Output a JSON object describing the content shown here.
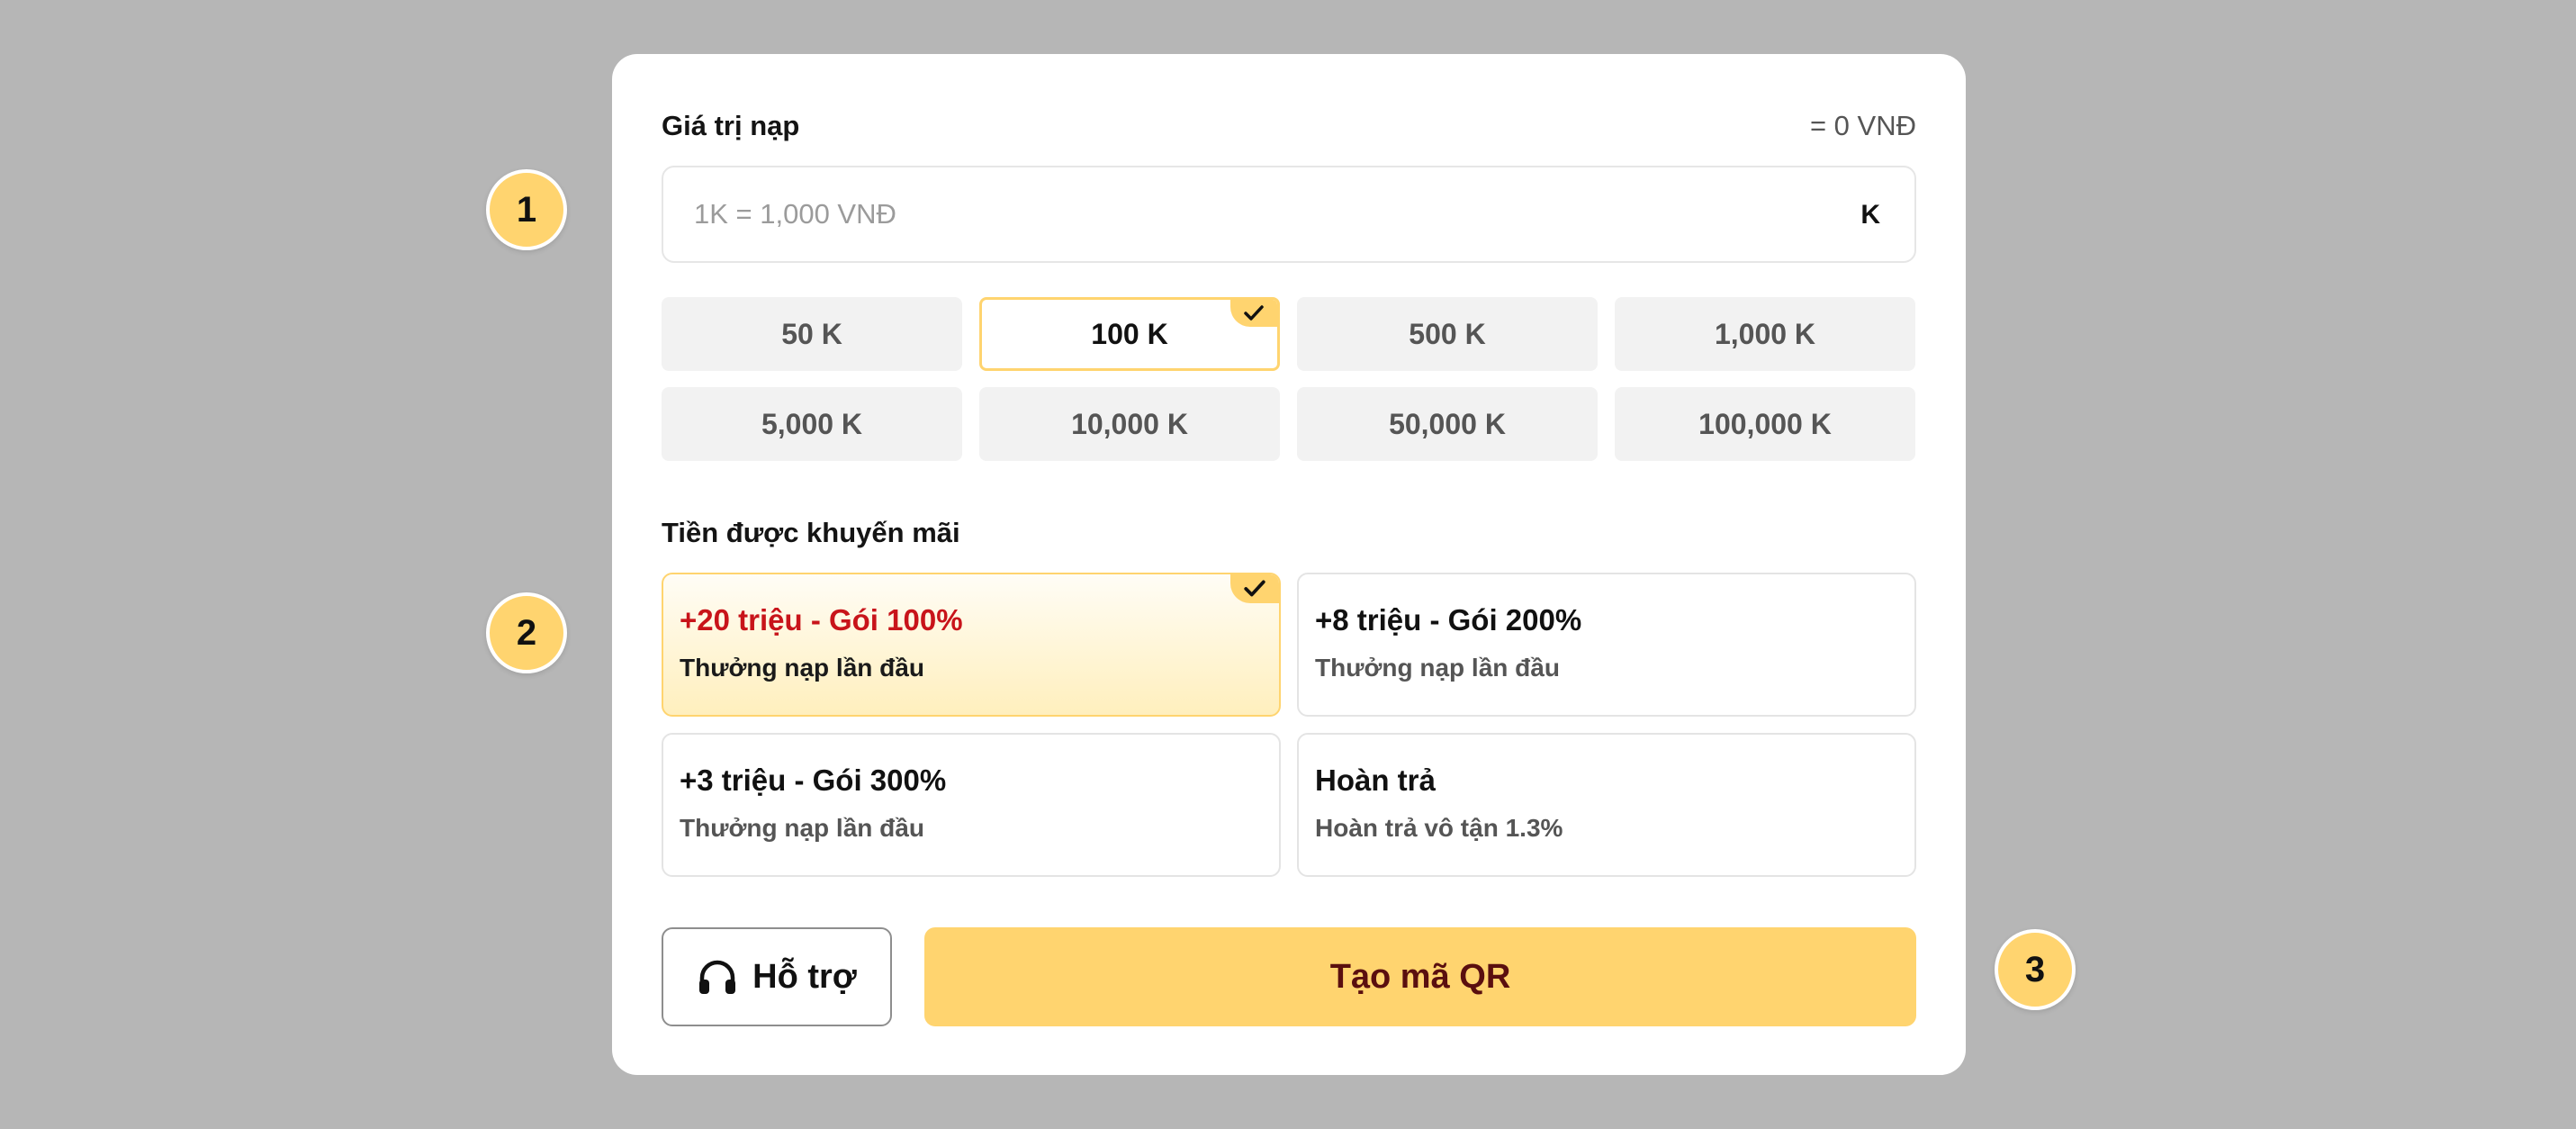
{
  "badges": [
    "1",
    "2",
    "3"
  ],
  "amount": {
    "label": "Giá trị nạp",
    "converted": "= 0 VNĐ",
    "placeholder": "1K = 1,000 VNĐ",
    "value": "",
    "unit": "K"
  },
  "presets": [
    {
      "label": "50 K",
      "selected": false
    },
    {
      "label": "100 K",
      "selected": true
    },
    {
      "label": "500 K",
      "selected": false
    },
    {
      "label": "1,000 K",
      "selected": false
    },
    {
      "label": "5,000 K",
      "selected": false
    },
    {
      "label": "10,000 K",
      "selected": false
    },
    {
      "label": "50,000 K",
      "selected": false
    },
    {
      "label": "100,000 K",
      "selected": false
    }
  ],
  "promo": {
    "label": "Tiền được khuyến mãi",
    "options": [
      {
        "title": "+20 triệu - Gói 100%",
        "subtitle": "Thưởng nạp lần đầu",
        "selected": true
      },
      {
        "title": "+8 triệu - Gói 200%",
        "subtitle": "Thưởng nạp lần đầu",
        "selected": false
      },
      {
        "title": "+3 triệu - Gói 300%",
        "subtitle": "Thưởng nạp lần đầu",
        "selected": false
      },
      {
        "title": "Hoàn trả",
        "subtitle": "Hoàn trả vô tận 1.3%",
        "selected": false
      }
    ]
  },
  "actions": {
    "support_label": "Hỗ trợ",
    "support_icon": "headphones-icon",
    "qr_label": "Tạo mã QR"
  },
  "colors": {
    "accent": "#ffd46f",
    "promo_highlight": "#c8141a",
    "qr_text": "#5a0f0f",
    "backdrop": "#b6b6b6"
  }
}
